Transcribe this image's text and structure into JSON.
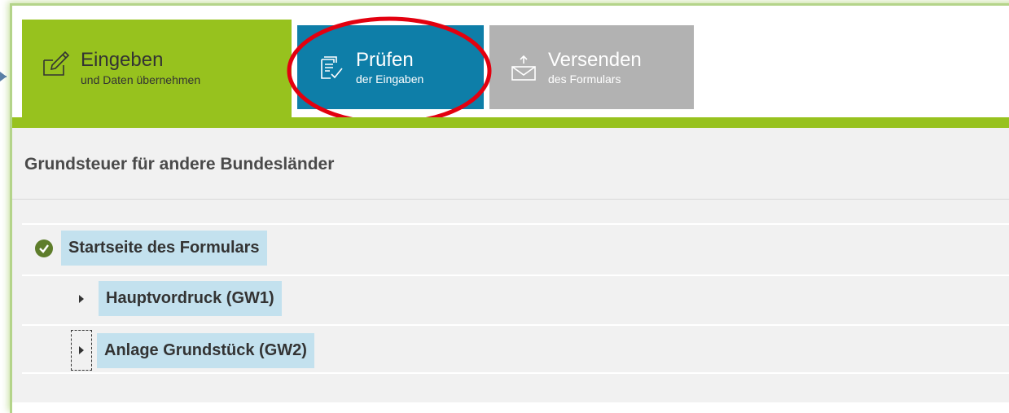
{
  "tabs": [
    {
      "title": "Eingeben",
      "subtitle": "und Daten übernehmen",
      "icon": "edit-icon",
      "color": "#97c21e"
    },
    {
      "title": "Prüfen",
      "subtitle": "der Eingaben",
      "icon": "checklist-icon",
      "color": "#0e7ea8"
    },
    {
      "title": "Versenden",
      "subtitle": "des Formulars",
      "icon": "send-mail-icon",
      "color": "#b2b2b2"
    }
  ],
  "page": {
    "title": "Grundsteuer für andere Bundesländer"
  },
  "tree": [
    {
      "label": "Startseite des Formulars",
      "status": "check-icon"
    },
    {
      "label": "Hauptvordruck (GW1)",
      "status": "expand-icon"
    },
    {
      "label": "Anlage Grundstück (GW2)",
      "status": "expand-icon"
    }
  ],
  "colors": {
    "accent_green": "#97c21e",
    "tab_blue": "#0e7ea8",
    "tab_gray": "#b2b2b2",
    "highlight": "#c3e1ee",
    "annotation_circle": "#e3000f"
  }
}
